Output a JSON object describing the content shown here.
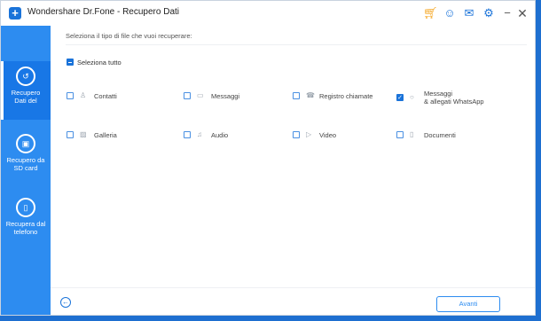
{
  "window": {
    "title": "Wondershare Dr.Fone - Recupero Dati"
  },
  "titlebar_icons": [
    "cart-icon",
    "user-icon",
    "feedback-icon",
    "settings-icon",
    "minimize-icon",
    "close-icon"
  ],
  "sidebar": {
    "items": [
      {
        "label_line1": "Recupero",
        "label_line2": "Dati del",
        "icon": "phone-recover-icon",
        "active": true
      },
      {
        "label_line1": "Recupero da",
        "label_line2": "SD card",
        "icon": "sdcard-icon",
        "active": false
      },
      {
        "label_line1": "Recupera dal",
        "label_line2": "telefono",
        "icon": "phone-icon",
        "active": false
      }
    ]
  },
  "main": {
    "prompt": "Seleziona il tipo di file che vuoi recuperare:",
    "select_all": "Seleziona tutto",
    "file_types": [
      {
        "label": "Contatti",
        "checked": false
      },
      {
        "label": "Messaggi",
        "checked": false
      },
      {
        "label": "Registro chiamate",
        "checked": false
      },
      {
        "label_line1": "Messaggi",
        "label_line2": "& allegati WhatsApp",
        "checked": true
      },
      {
        "label": "Galleria",
        "checked": false
      },
      {
        "label": "Audio",
        "checked": false
      },
      {
        "label": "Video",
        "checked": false
      },
      {
        "label": "Documenti",
        "checked": false
      }
    ],
    "next_button": "Avanti"
  },
  "colors": {
    "accent": "#2d8cf0",
    "sidebar_bg": "#2d8cf0",
    "checkbox_checked": "#1a73d9"
  }
}
